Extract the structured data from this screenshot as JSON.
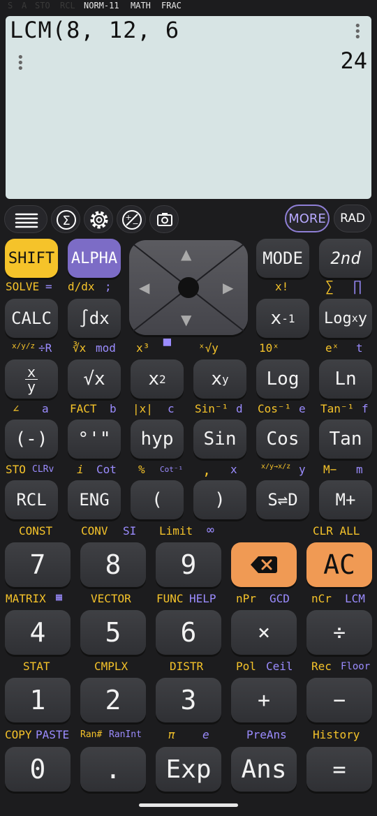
{
  "status_bar": {
    "s": "S",
    "a": "A",
    "sto": "STO",
    "rcl": "RCL",
    "norm": "NORM-11",
    "math": "MATH",
    "frac": "FRAC"
  },
  "display": {
    "expression": "LCM(8, 12, 6",
    "result": "24"
  },
  "toolbar": {
    "more": "MORE",
    "rad": "RAD",
    "icons": [
      "menu-icon",
      "sum-icon",
      "settings-icon",
      "plus-minus-icon",
      "camera-icon"
    ]
  },
  "dpad": {
    "up": "▲",
    "down": "▼",
    "left": "◀",
    "right": "▶"
  },
  "row1": {
    "shift": "SHIFT",
    "alpha": "ALPHA",
    "mode": "MODE",
    "second": "2nd"
  },
  "row1_labels": {
    "solve": "SOLVE",
    "solve_eq": "=",
    "ddx": "d/dx",
    "semicolon": ";",
    "xfact": "x!",
    "sigma": "∑",
    "pi_prod": "∏"
  },
  "row2": {
    "calc": "CALC",
    "integral": "∫dx",
    "xinv_base": "x",
    "xinv_exp": "-1",
    "log_base": "Log",
    "log_sub": "x",
    "log_y": "y"
  },
  "row2_labels": {
    "frac": "x/y/z",
    "div_r": "÷R",
    "cbrt": "∛x",
    "mod": "mod",
    "x3": "x³",
    "tenx": "10ˣ",
    "ex": "eˣ",
    "t": "t"
  },
  "row3": {
    "frac_top": "x",
    "frac_bot": "y",
    "sqrt": "√x",
    "x2_base": "x",
    "x2_exp": "2",
    "xy_base": "x",
    "xy_exp": "y",
    "log": "Log",
    "ln": "Ln"
  },
  "row3_labels": {
    "angle": "∠",
    "a": "a",
    "fact": "FACT",
    "b": "b",
    "abs": "|x|",
    "c": "c",
    "sin_inv": "Sin⁻¹",
    "d": "d",
    "cos_inv": "Cos⁻¹",
    "e": "e",
    "tan_inv": "Tan⁻¹",
    "f": "f"
  },
  "row4": {
    "neg": "(-)",
    "deg": "°'\"",
    "hyp": "hyp",
    "sin": "Sin",
    "cos": "Cos",
    "tan": "Tan"
  },
  "row4_labels": {
    "sto": "STO",
    "clrv": "CLRv",
    "i": "i",
    "cot": "Cot",
    "pct": "%",
    "cot_inv": "Cot⁻¹",
    "comma": ",",
    "x": "x",
    "conv": "x/y→x/z",
    "y": "y",
    "mminus": "M−",
    "m": "m"
  },
  "row5": {
    "rcl": "RCL",
    "eng": "ENG",
    "lparen": "(",
    "rparen": ")",
    "sd": "S⇌D",
    "mplus": "M+"
  },
  "row5_labels": {
    "const": "CONST",
    "conv": "CONV",
    "si": "SI",
    "limit": "Limit",
    "inf": "∞",
    "clrall": "CLR ALL"
  },
  "row6": {
    "k7": "7",
    "k8": "8",
    "k9": "9",
    "del": "⌫",
    "ac": "AC"
  },
  "row6_labels": {
    "matrix": "MATRIX",
    "vector": "VECTOR",
    "func": "FUNC",
    "help": "HELP",
    "npr": "nPr",
    "gcd": "GCD",
    "ncr": "nCr",
    "lcm": "LCM"
  },
  "row7": {
    "k4": "4",
    "k5": "5",
    "k6": "6",
    "mul": "×",
    "div": "÷"
  },
  "row7_labels": {
    "stat": "STAT",
    "cmplx": "CMPLX",
    "distr": "DISTR",
    "pol": "Pol",
    "ceil": "Ceil",
    "rec": "Rec",
    "floor": "Floor"
  },
  "row8": {
    "k1": "1",
    "k2": "2",
    "k3": "3",
    "plus": "+",
    "minus": "−"
  },
  "row8_labels": {
    "copy": "COPY",
    "paste": "PASTE",
    "ranhash": "Ran#",
    "ranint": "RanInt",
    "pi": "π",
    "e": "e",
    "preans": "PreAns",
    "history": "History"
  },
  "row9": {
    "k0": "0",
    "dot": ".",
    "exp": "Exp",
    "ans": "Ans",
    "eq": "="
  },
  "colors": {
    "bg": "#1c1c1e",
    "display": "#d7e4e4",
    "shift": "#f5c32a",
    "alpha": "#7c6cc6",
    "del": "#f09a54",
    "yellow": "#f5c32a",
    "purple": "#9b8cff"
  }
}
